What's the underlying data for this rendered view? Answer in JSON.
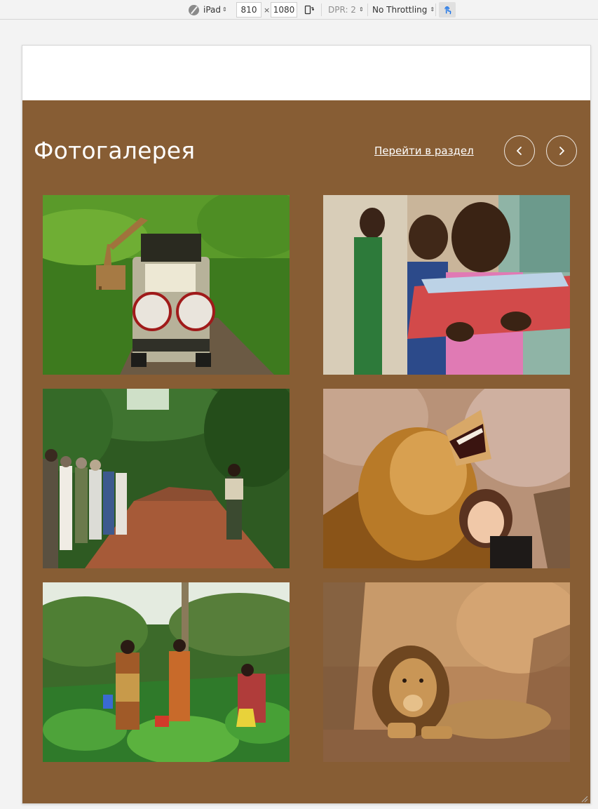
{
  "devtools": {
    "device": "iPad",
    "width": "810",
    "times": "×",
    "height": "1080",
    "dpr": "DPR: 2",
    "throttling": "No Throttling"
  },
  "gallery": {
    "title": "Фотогалерея",
    "section_link": "Перейти в раздел",
    "background": "#875d34",
    "photos": [
      {
        "subject": "giraffe and safari jeep"
      },
      {
        "subject": "children holding notebooks"
      },
      {
        "subject": "tour group on forest path"
      },
      {
        "subject": "roaring lion with smiling girl"
      },
      {
        "subject": "women working in vegetable field"
      },
      {
        "subject": "lion resting in dry bush"
      }
    ]
  }
}
